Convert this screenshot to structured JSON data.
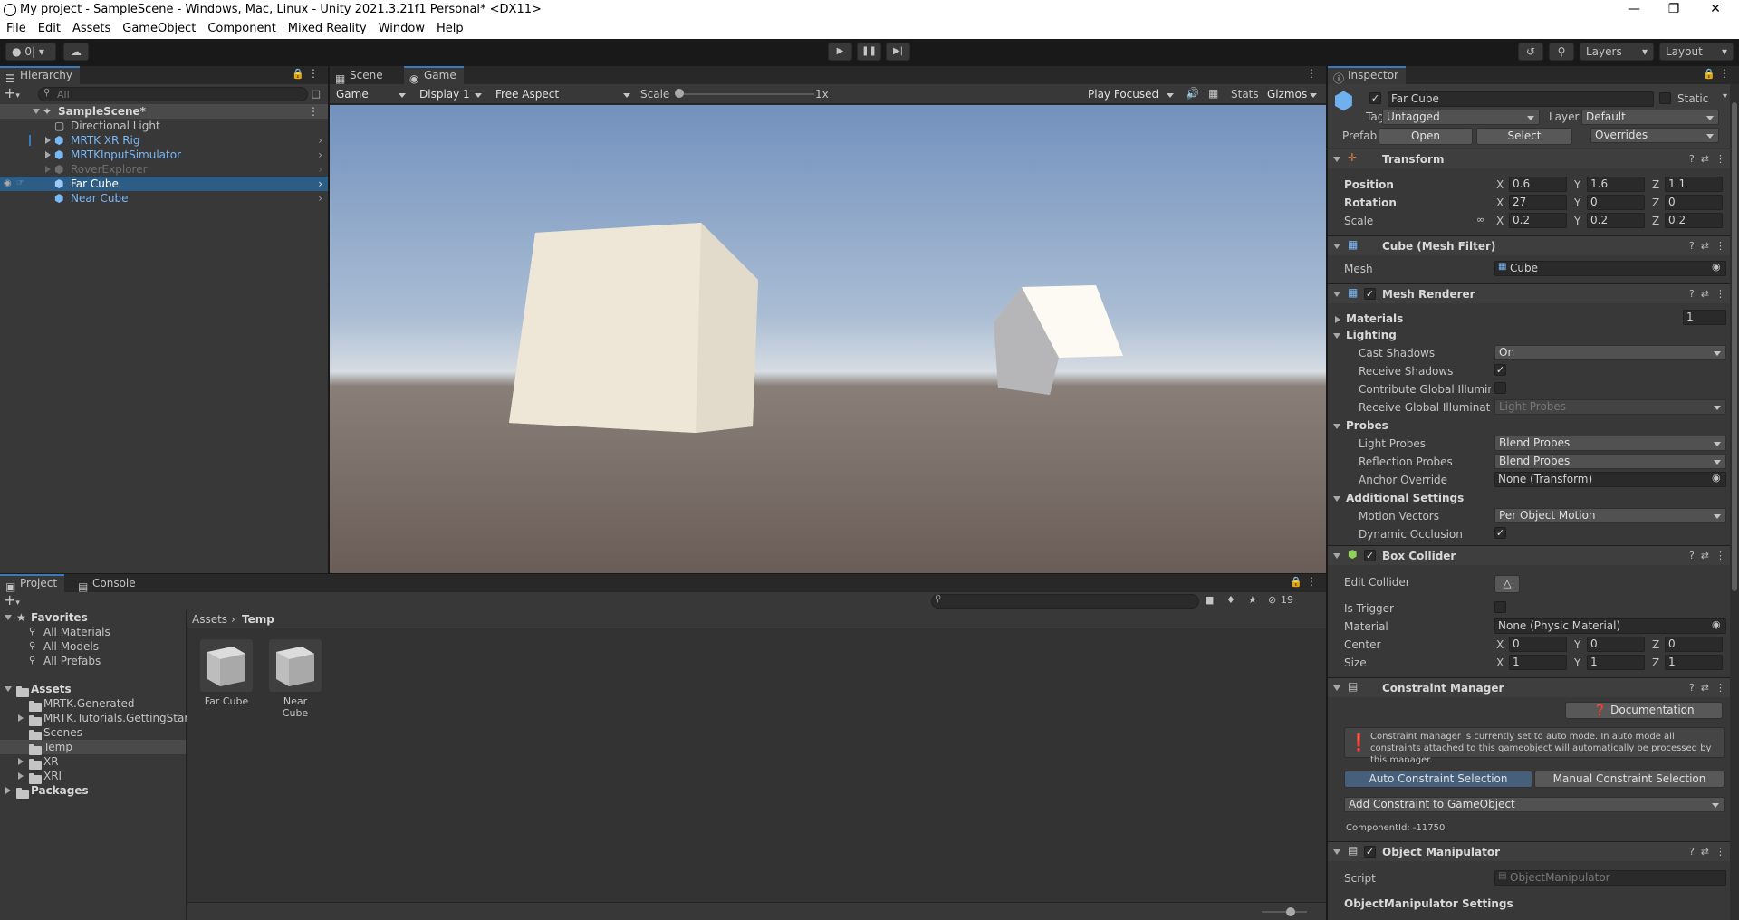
{
  "window": {
    "title": "My project - SampleScene - Windows, Mac, Linux - Unity 2021.3.21f1 Personal* <DX11>"
  },
  "menu": [
    "File",
    "Edit",
    "Assets",
    "GameObject",
    "Component",
    "Mixed Reality",
    "Window",
    "Help"
  ],
  "toolbar": {
    "account": "0|",
    "layers": "Layers",
    "layout": "Layout"
  },
  "hierarchy": {
    "tab": "Hierarchy",
    "search_placeholder": "All",
    "scene": "SampleScene*",
    "items": [
      "Directional Light",
      "MRTK XR Rig",
      "MRTKInputSimulator",
      "RoverExplorer",
      "Far Cube",
      "Near Cube"
    ]
  },
  "game": {
    "tabs": [
      "Scene",
      "Game"
    ],
    "display_mode": "Game",
    "display": "Display 1",
    "aspect": "Free Aspect",
    "scale_label": "Scale",
    "scale_value": "1x",
    "play_mode": "Play Focused",
    "stats": "Stats",
    "gizmos": "Gizmos"
  },
  "project": {
    "tabs": [
      "Project",
      "Console"
    ],
    "favorites_label": "Favorites",
    "favorites": [
      "All Materials",
      "All Models",
      "All Prefabs"
    ],
    "assets_label": "Assets",
    "assets": [
      "MRTK.Generated",
      "MRTK.Tutorials.GettingStart",
      "Scenes",
      "Temp",
      "XR",
      "XRI"
    ],
    "packages_label": "Packages",
    "breadcrumb": [
      "Assets",
      "Temp"
    ],
    "hidden_count": "19",
    "files": [
      "Far Cube",
      "Near Cube"
    ]
  },
  "inspector": {
    "tab": "Inspector",
    "object_name": "Far Cube",
    "static_label": "Static",
    "tag_label": "Tag",
    "tag": "Untagged",
    "layer_label": "Layer",
    "layer": "Default",
    "prefab_label": "Prefab",
    "prefab_open": "Open",
    "prefab_select": "Select",
    "prefab_overrides": "Overrides",
    "transform": {
      "title": "Transform",
      "position_label": "Position",
      "position": [
        "0.6",
        "1.6",
        "1.1"
      ],
      "rotation_label": "Rotation",
      "rotation": [
        "27",
        "0",
        "0"
      ],
      "scale_label": "Scale",
      "scale": [
        "0.2",
        "0.2",
        "0.2"
      ]
    },
    "mesh_filter": {
      "title": "Cube (Mesh Filter)",
      "mesh_label": "Mesh",
      "mesh": "Cube"
    },
    "mesh_renderer": {
      "title": "Mesh Renderer",
      "materials_label": "Materials",
      "materials_count": "1",
      "lighting_label": "Lighting",
      "cast_shadows_label": "Cast Shadows",
      "cast_shadows": "On",
      "receive_shadows_label": "Receive Shadows",
      "contribute_gi_label": "Contribute Global Illuminat",
      "receive_gi_label": "Receive Global Illuminatior",
      "receive_gi": "Light Probes",
      "probes_label": "Probes",
      "light_probes_label": "Light Probes",
      "light_probes": "Blend Probes",
      "reflection_probes_label": "Reflection Probes",
      "reflection_probes": "Blend Probes",
      "anchor_override_label": "Anchor Override",
      "anchor_override": "None (Transform)",
      "additional_label": "Additional Settings",
      "motion_vectors_label": "Motion Vectors",
      "motion_vectors": "Per Object Motion",
      "dynamic_occlusion_label": "Dynamic Occlusion"
    },
    "box_collider": {
      "title": "Box Collider",
      "edit_collider_label": "Edit Collider",
      "is_trigger_label": "Is Trigger",
      "material_label": "Material",
      "material": "None (Physic Material)",
      "center_label": "Center",
      "center": [
        "0",
        "0",
        "0"
      ],
      "size_label": "Size",
      "size": [
        "1",
        "1",
        "1"
      ]
    },
    "constraint_manager": {
      "title": "Constraint Manager",
      "documentation": "Documentation",
      "info": "Constraint manager is currently set to auto mode. In auto mode all constraints attached to this gameobject will automatically be processed by this manager.",
      "auto": "Auto Constraint Selection",
      "manual": "Manual Constraint Selection",
      "add": "Add Constraint to GameObject",
      "component_id": "ComponentId: -11750"
    },
    "object_manipulator": {
      "title": "Object Manipulator",
      "script_label": "Script",
      "script": "ObjectManipulator",
      "settings_label": "ObjectManipulator Settings"
    }
  }
}
